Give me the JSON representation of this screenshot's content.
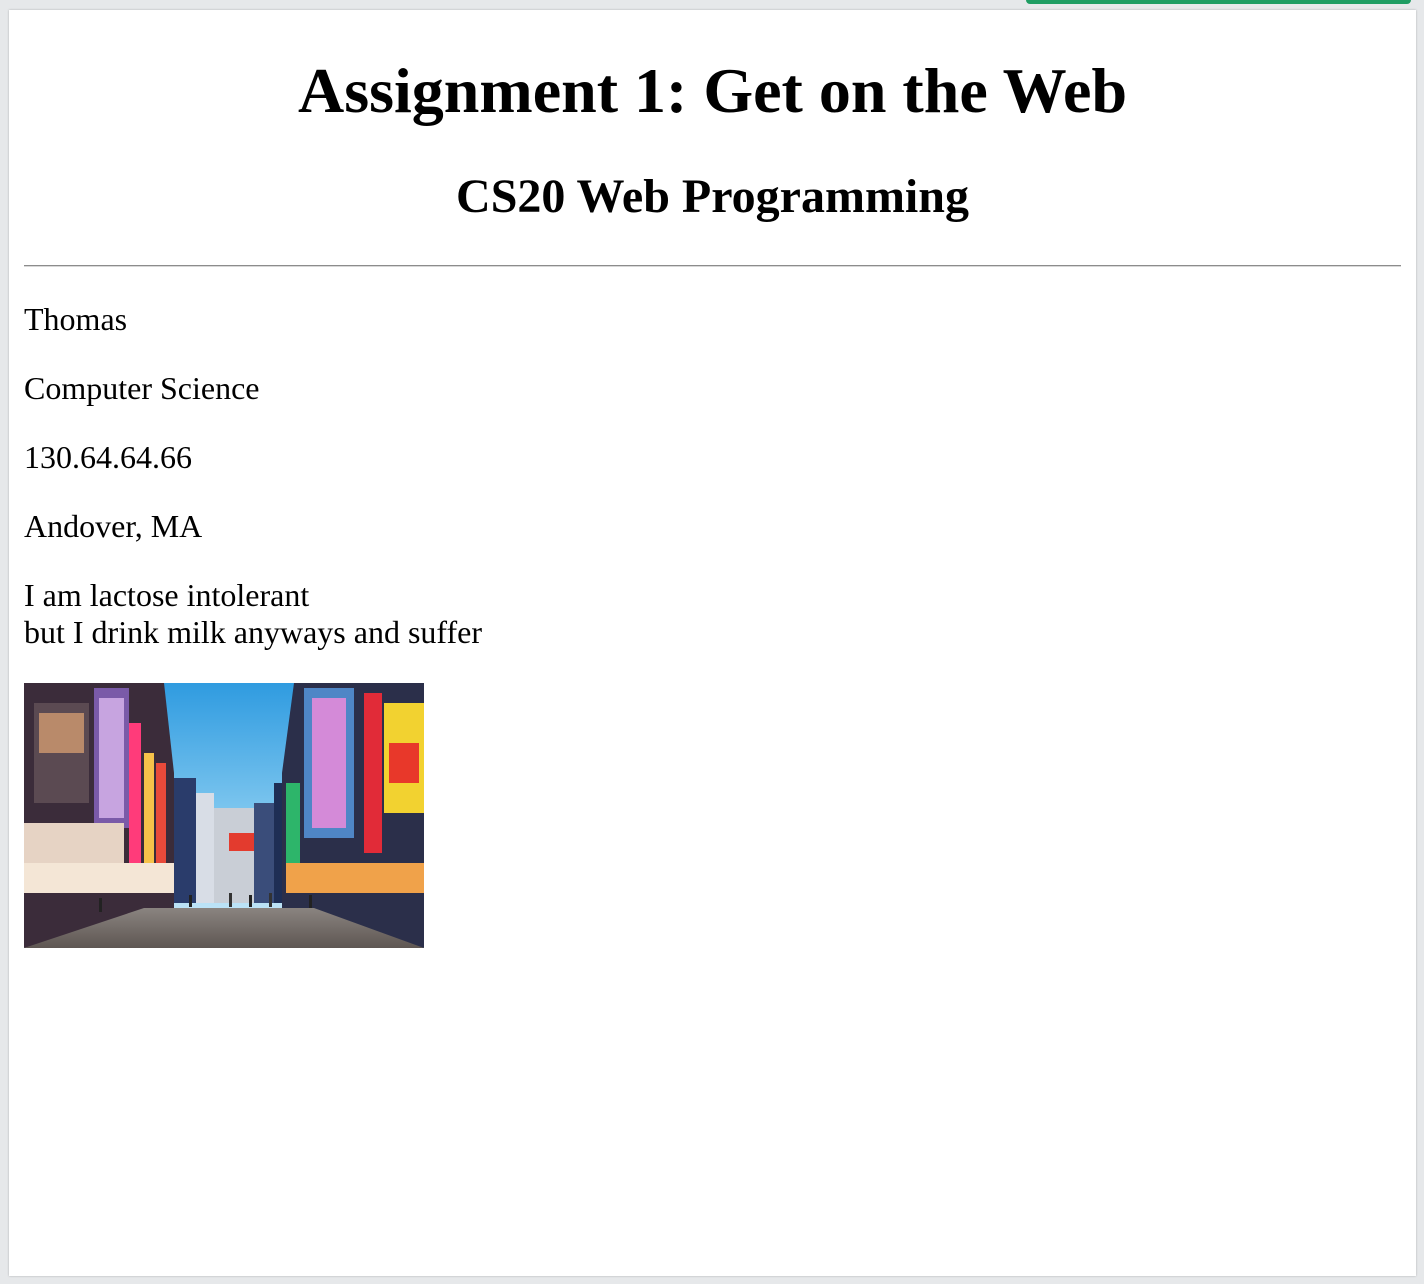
{
  "header": {
    "title": "Assignment 1: Get on the Web",
    "subtitle": "CS20 Web Programming"
  },
  "profile": {
    "name": "Thomas",
    "major": "Computer Science",
    "ip_address": "130.64.64.66",
    "location": "Andover, MA",
    "fact_line1": "I am lactose intolerant",
    "fact_line2": "but I drink milk anyways and suffer"
  },
  "photo": {
    "icon": "city-street-photo"
  },
  "colors": {
    "background": "#ffffff",
    "text": "#000000",
    "accent_strip": "#1f9d63"
  }
}
